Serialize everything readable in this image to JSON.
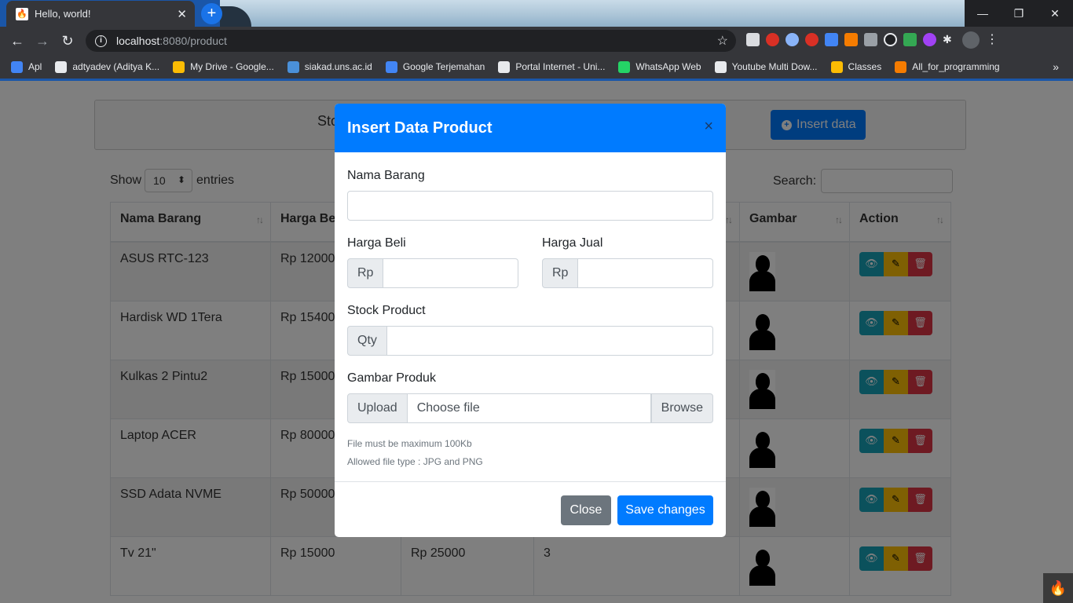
{
  "browser": {
    "tab_title": "Hello, world!",
    "url_host": "localhost",
    "url_rest": ":8080/product",
    "bookmarks": [
      {
        "label": "Apl",
        "color": "#4285f4"
      },
      {
        "label": "adtyadev (Aditya K...",
        "color": "#e8eaed"
      },
      {
        "label": "My Drive - Google...",
        "color": "#fbbc04"
      },
      {
        "label": "siakad.uns.ac.id",
        "color": "#4a90d9"
      },
      {
        "label": "Google Terjemahan",
        "color": "#4285f4"
      },
      {
        "label": "Portal Internet - Uni...",
        "color": "#e8eaed"
      },
      {
        "label": "WhatsApp Web",
        "color": "#25d366"
      },
      {
        "label": "Youtube Multi Dow...",
        "color": "#e8eaed"
      },
      {
        "label": "Classes",
        "color": "#fbbc04"
      },
      {
        "label": "All_for_programming",
        "color": "#f57c00"
      }
    ]
  },
  "page": {
    "card_title": "Sto",
    "insert_button": "Insert data",
    "show_label": "Show",
    "entries_value": "10",
    "entries_label": "entries",
    "search_label": "Search:",
    "columns": [
      "Nama Barang",
      "Harga Be",
      "",
      "",
      "Gambar",
      "Action"
    ],
    "rows": [
      {
        "nama": "ASUS RTC-123",
        "beli": "Rp 12000",
        "jual": "",
        "stock": ""
      },
      {
        "nama": "Hardisk WD 1Tera",
        "beli": "Rp 15400",
        "jual": "",
        "stock": ""
      },
      {
        "nama": "Kulkas 2 Pintu2",
        "beli": "Rp 15000",
        "jual": "",
        "stock": ""
      },
      {
        "nama": "Laptop ACER",
        "beli": "Rp 80000",
        "jual": "",
        "stock": ""
      },
      {
        "nama": "SSD Adata NVME",
        "beli": "Rp 50000",
        "jual": "",
        "stock": ""
      },
      {
        "nama": "Tv 21\"",
        "beli": "Rp 15000",
        "jual": "Rp 25000",
        "stock": "3"
      }
    ]
  },
  "modal": {
    "title": "Insert Data Product",
    "close_symbol": "×",
    "nama_label": "Nama Barang",
    "beli_label": "Harga Beli",
    "jual_label": "Harga Jual",
    "rp_prefix": "Rp",
    "stock_label": "Stock Product",
    "qty_prefix": "Qty",
    "gambar_label": "Gambar Produk",
    "upload_prefix": "Upload",
    "file_placeholder": "Choose file",
    "browse_label": "Browse",
    "help_size": "File must be maximum 100Kb",
    "help_type": "Allowed file type : JPG and PNG",
    "close_button": "Close",
    "save_button": "Save changes"
  }
}
